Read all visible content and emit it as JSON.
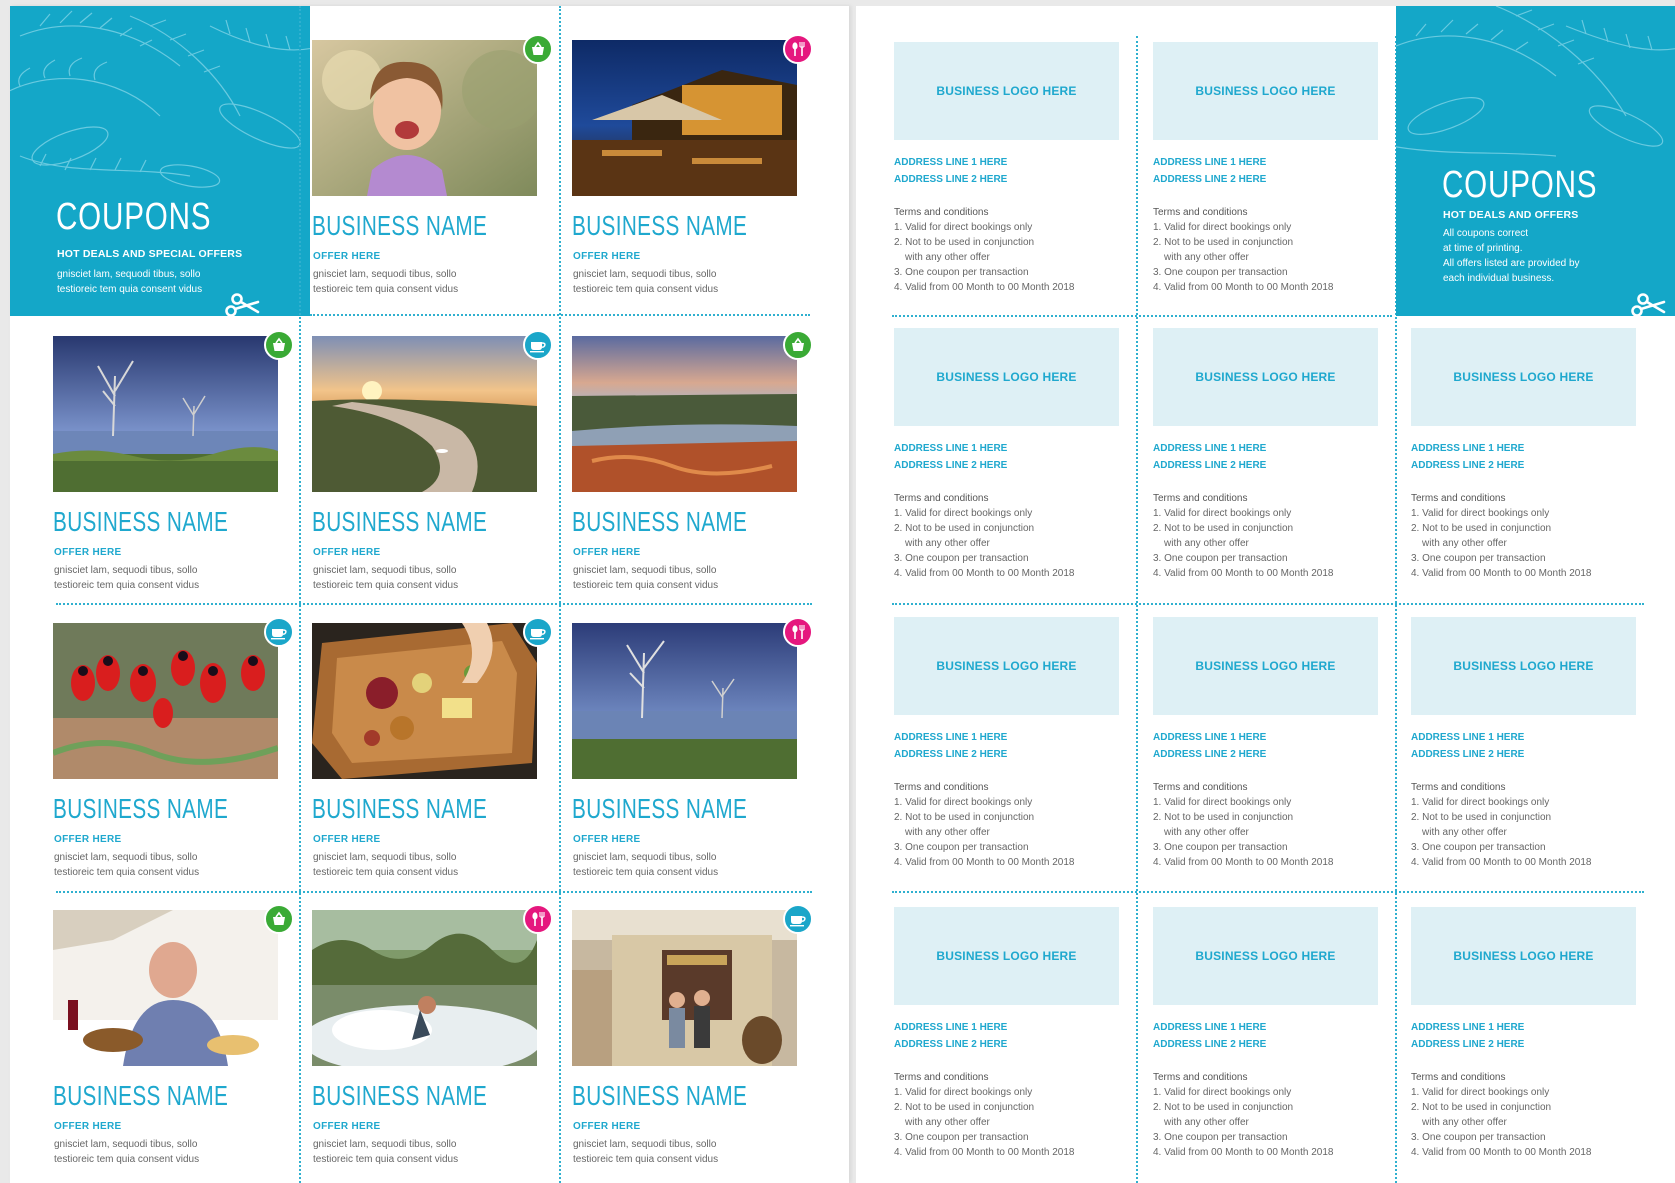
{
  "left_banner": {
    "title": "COUPONS",
    "subtitle": "HOT DEALS AND SPECIAL OFFERS",
    "text_line1": "gnisciet lam, sequodi tibus, sollo",
    "text_line2": "testioreic tem quia consent vidus"
  },
  "right_banner": {
    "title": "COUPONS",
    "subtitle": "HOT DEALS AND OFFERS",
    "text_line1": "All coupons correct",
    "text_line2": "at time of printing.",
    "text_line3": "All offers listed are provided by",
    "text_line4": "each individual business."
  },
  "coupon": {
    "business_name": "BUSINESS NAME",
    "offer": "OFFER HERE",
    "desc_line1": "gnisciet lam, sequodi tibus, sollo",
    "desc_line2": "testioreic tem quia consent vidus"
  },
  "back": {
    "logo": "BUSINESS LOGO HERE",
    "address1": "ADDRESS LINE 1 HERE",
    "address2": "ADDRESS LINE 2 HERE",
    "terms_title": "Terms and conditions",
    "term1": "1. Valid for direct bookings only",
    "term2": "2. Not to be used in conjunction",
    "term2b": "with any other offer",
    "term3": "3. One coupon per transaction",
    "term4": "4. Valid from 00 Month to 00 Month 2018"
  },
  "icons": {
    "shopping": {
      "icon": "shopping-basket-icon",
      "color": "#3aaa35"
    },
    "dining": {
      "icon": "fork-knife-icon",
      "color": "#e5177e"
    },
    "cafe": {
      "icon": "coffee-cup-icon",
      "color": "#1aa6c9"
    }
  },
  "left_coupons": [
    {
      "scene": "girl-eating",
      "badge": "shopping"
    },
    {
      "scene": "restaurant-night",
      "badge": "dining"
    },
    {
      "scene": "lake-trees",
      "badge": "shopping"
    },
    {
      "scene": "river-sunset",
      "badge": "cafe"
    },
    {
      "scene": "cliffs-river",
      "badge": "shopping"
    },
    {
      "scene": "red-flowers",
      "badge": "cafe"
    },
    {
      "scene": "platter",
      "badge": "cafe"
    },
    {
      "scene": "lake-trees-2",
      "badge": "dining"
    },
    {
      "scene": "man-dining",
      "badge": "shopping"
    },
    {
      "scene": "wakeboard",
      "badge": "dining"
    },
    {
      "scene": "stone-cottage",
      "badge": "cafe"
    }
  ]
}
